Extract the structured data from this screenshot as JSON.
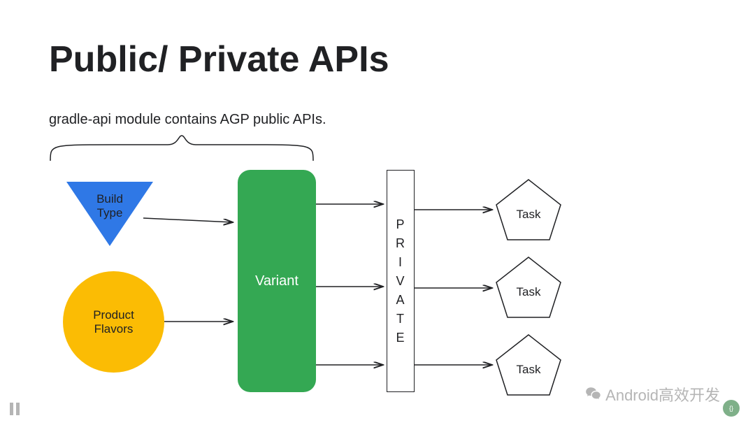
{
  "title": "Public/ Private APIs",
  "subtitle": "gradle-api module contains AGP public APIs.",
  "shapes": {
    "buildType": {
      "line1": "Build",
      "line2": "Type"
    },
    "productFlavors": {
      "line1": "Product",
      "line2": "Flavors"
    },
    "variant": "Variant",
    "private": "PRIVATE",
    "task1": "Task",
    "task2": "Task",
    "task3": "Task"
  },
  "colors": {
    "blue": "#2F78E6",
    "yellow": "#FBBC04",
    "green": "#34A853",
    "stroke": "#202124"
  },
  "watermark": {
    "text": "Android高效开发"
  },
  "controls": {
    "pauseIcon": "pause",
    "avatarInitial": "{}"
  }
}
